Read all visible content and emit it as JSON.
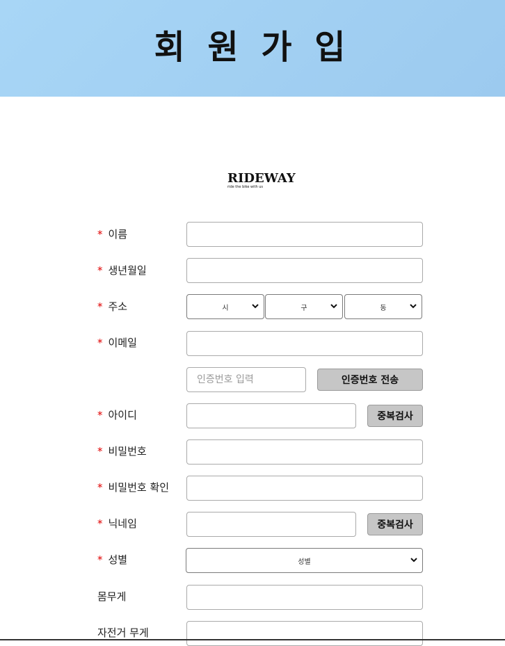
{
  "header": {
    "title": "회 원 가 입",
    "bg_color": "#a0cdf0"
  },
  "logo": {
    "name": "RIDEWAY",
    "tagline": "ride the bike with us"
  },
  "required_mark": "*",
  "fields": {
    "name": {
      "label": "이름",
      "value": ""
    },
    "birth": {
      "label": "생년월일",
      "value": ""
    },
    "address": {
      "label": "주소",
      "city": "시",
      "district": "구",
      "dong": "동"
    },
    "email": {
      "label": "이메일",
      "value": ""
    },
    "auth": {
      "placeholder": "인증번호 입력",
      "send_button": "인증번호 전송"
    },
    "userid": {
      "label": "아이디",
      "check_button": "중복검사"
    },
    "password": {
      "label": "비밀번호"
    },
    "password_confirm": {
      "label": "비밀번호 확인"
    },
    "nickname": {
      "label": "닉네임",
      "check_button": "중복검사"
    },
    "gender": {
      "label": "성별",
      "selected": "성별"
    },
    "weight": {
      "label": "몸무게"
    },
    "bike_weight": {
      "label": "자전거 무게"
    }
  },
  "colors": {
    "required": "#e00000",
    "button_bg": "#c6c6c6"
  }
}
